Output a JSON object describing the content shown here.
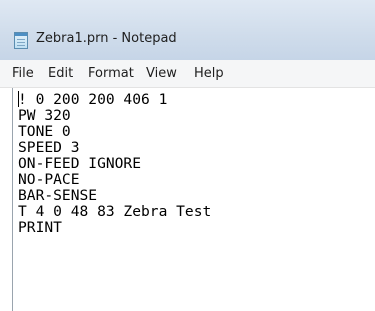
{
  "window": {
    "title": "Zebra1.prn - Notepad",
    "icon": "notepad-icon"
  },
  "menu": {
    "items": [
      "File",
      "Edit",
      "Format",
      "View",
      "Help"
    ]
  },
  "editor": {
    "lines": [
      "! 0 200 200 406 1",
      "PW 320",
      "TONE 0",
      "SPEED 3",
      "ON-FEED IGNORE",
      "NO-PACE",
      "BAR-SENSE",
      "T 4 0 48 83 Zebra Test",
      "PRINT"
    ]
  }
}
